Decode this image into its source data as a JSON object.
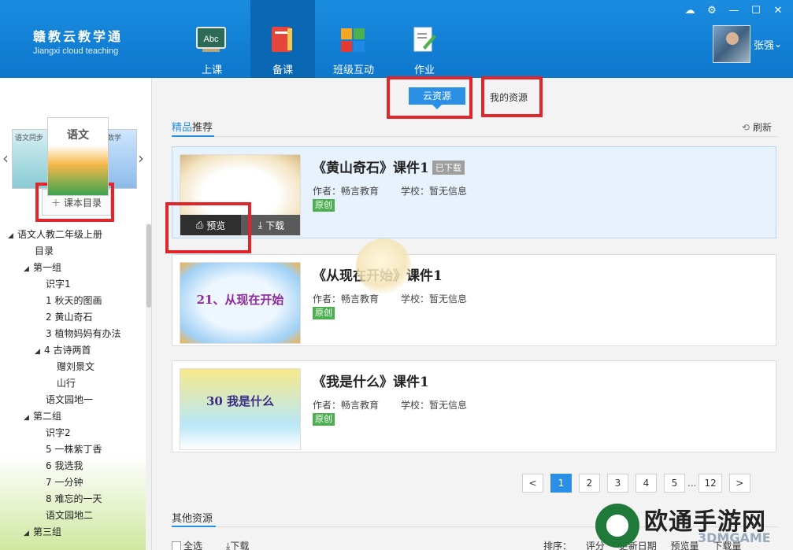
{
  "brand": {
    "cn": "赣教云教学通",
    "en": "Jiangxi cloud teaching"
  },
  "nav": [
    {
      "label": "上课",
      "icon": "abc-board-icon"
    },
    {
      "label": "备课",
      "icon": "notebook-icon"
    },
    {
      "label": "班级互动",
      "icon": "blocks-icon"
    },
    {
      "label": "作业",
      "icon": "edit-document-icon"
    }
  ],
  "window": {
    "icons": [
      "cloud-icon",
      "gear-icon",
      "minimize-icon",
      "maximize-icon",
      "close-icon"
    ]
  },
  "user": {
    "name": "张强",
    "caret": "⌄"
  },
  "sidebar": {
    "toc_button": "课本目录",
    "book_mid_title": "语文",
    "book_left_title": "语文同步",
    "book_right_title": "数学",
    "tree": [
      {
        "label": "语文人教二年级上册",
        "level": 0,
        "toggle": "◢"
      },
      {
        "label": "目录",
        "level": 1,
        "toggle": ""
      },
      {
        "label": "第一组",
        "level": 1,
        "toggle": "◢"
      },
      {
        "label": "识字1",
        "level": 2,
        "toggle": ""
      },
      {
        "label": "1 秋天的图画",
        "level": 2,
        "toggle": ""
      },
      {
        "label": "2 黄山奇石",
        "level": 2,
        "toggle": ""
      },
      {
        "label": "3 植物妈妈有办法",
        "level": 2,
        "toggle": ""
      },
      {
        "label": "4 古诗两首",
        "level": 2,
        "toggle": "◢"
      },
      {
        "label": "赠刘景文",
        "level": 3,
        "toggle": ""
      },
      {
        "label": "山行",
        "level": 3,
        "toggle": ""
      },
      {
        "label": "语文园地一",
        "level": 2,
        "toggle": ""
      },
      {
        "label": "第二组",
        "level": 1,
        "toggle": "◢"
      },
      {
        "label": "识字2",
        "level": 2,
        "toggle": ""
      },
      {
        "label": "5 一株紫丁香",
        "level": 2,
        "toggle": ""
      },
      {
        "label": "6 我选我",
        "level": 2,
        "toggle": ""
      },
      {
        "label": "7 一分钟",
        "level": 2,
        "toggle": ""
      },
      {
        "label": "8 难忘的一天",
        "level": 2,
        "toggle": ""
      },
      {
        "label": "语文园地二",
        "level": 2,
        "toggle": ""
      },
      {
        "label": "第三组",
        "level": 1,
        "toggle": "◢"
      }
    ]
  },
  "resource_tabs": {
    "cloud": "云资源",
    "mine": "我的资源"
  },
  "featured": {
    "title_hl": "精品",
    "title_rest": "推荐",
    "refresh": "刷新"
  },
  "cards": [
    {
      "title": "《黄山奇石》课件1",
      "badge": "已下载",
      "author": "作者：畅言教育",
      "school": "学校：暂无信息",
      "tag": "原创",
      "thumb_text": "",
      "preview": "预览",
      "download": "下载"
    },
    {
      "title": "《从现在开始》课件1",
      "badge": "",
      "author": "作者：畅言教育",
      "school": "学校：暂无信息",
      "tag": "原创",
      "thumb_text": "21、从现在开始"
    },
    {
      "title": "《我是什么》课件1",
      "badge": "",
      "author": "作者：畅言教育",
      "school": "学校：暂无信息",
      "tag": "原创",
      "thumb_text": "30  我是什么"
    }
  ],
  "pager": {
    "prev": "<",
    "pages": [
      "1",
      "2",
      "3",
      "4",
      "5"
    ],
    "ellipsis": "...",
    "last": "12",
    "next": ">",
    "current": "1"
  },
  "other": {
    "title": "其他资源",
    "select_all": "全选",
    "download": "下载",
    "sort_label": "排序：",
    "sort_options": [
      "评分",
      "更新日期",
      "预览量",
      "下载量"
    ]
  },
  "watermark": {
    "text": "欧通手游网",
    "sub": "3DMGAME"
  },
  "colors": {
    "header": "#1a8ce0",
    "accent": "#2b8fe6",
    "highlight": "#e0262b",
    "tag": "#4caf50"
  }
}
